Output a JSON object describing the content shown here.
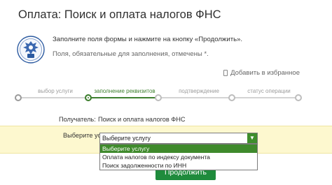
{
  "page": {
    "title": "Оплата: Поиск и оплата налогов ФНС",
    "instruction": "Заполните поля формы и нажмите на кнопку «Продолжить».",
    "required_note": "Поля, обязательные для заполнения, отмечены *."
  },
  "favorites": {
    "label": "Добавить в избранное",
    "icon": "bookmark-icon"
  },
  "steps": {
    "items": [
      {
        "label": "выбор услуги",
        "state": "done"
      },
      {
        "label": "заполнение реквизитов",
        "state": "active"
      },
      {
        "label": "подтверждение",
        "state": "pending"
      },
      {
        "label": "статус операции",
        "state": "pending"
      }
    ]
  },
  "form": {
    "recipient_label": "Получатель:",
    "recipient_value": "Поиск и оплата налогов ФНС",
    "service_label": "Выберите услугу*:",
    "service_selected": "Выберите услугу",
    "service_options": [
      "Выберите услугу",
      "Оплата налогов по индексу документа",
      "Поиск задолженности по ИНН"
    ]
  },
  "continue_button": {
    "label": "Продолжить"
  },
  "colors": {
    "accent_green": "#3e7f2f",
    "button_green": "#1f8b3c",
    "highlight_row": "#fdf8cf"
  }
}
